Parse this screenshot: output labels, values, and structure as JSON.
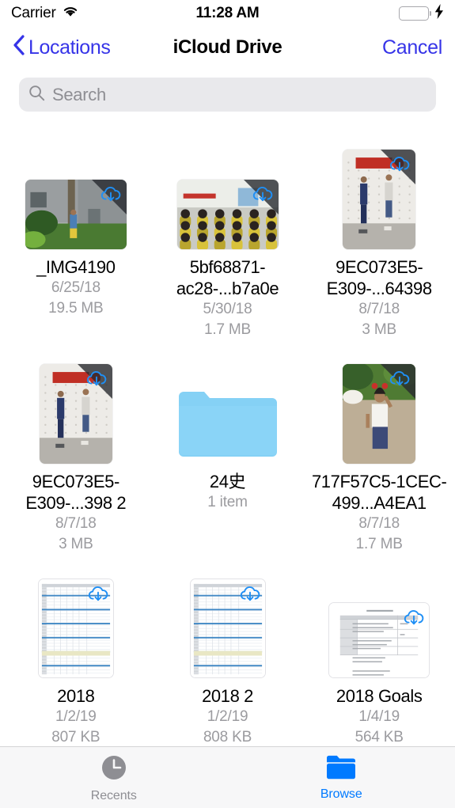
{
  "status_bar": {
    "carrier": "Carrier",
    "wifi_icon": "wifi-icon",
    "time": "11:28 AM",
    "battery_icon": "battery-icon",
    "battery_color": "#4cd964",
    "charging_icon": "lightning-bolt-icon"
  },
  "nav": {
    "back_icon": "chevron-left-icon",
    "back_label": "Locations",
    "title": "iCloud Drive",
    "cancel_label": "Cancel",
    "tint_color": "#3634e8"
  },
  "search": {
    "icon": "search-icon",
    "placeholder": "Search",
    "value": ""
  },
  "files": [
    {
      "name": "_IMG4190",
      "date": "6/25/18",
      "size": "19.5 MB",
      "kind": "photo",
      "orientation": "landscape",
      "status_icon": "icloud-download-icon"
    },
    {
      "name": "5bf68871-ac28-...b7a0e",
      "date": "5/30/18",
      "size": "1.7 MB",
      "kind": "photo",
      "orientation": "landscape",
      "status_icon": "icloud-download-icon"
    },
    {
      "name": "9EC073E5-E309-...64398",
      "date": "8/7/18",
      "size": "3 MB",
      "kind": "photo",
      "orientation": "portrait",
      "status_icon": "icloud-download-icon"
    },
    {
      "name": "9EC073E5-E309-...398 2",
      "date": "8/7/18",
      "size": "3 MB",
      "kind": "photo",
      "orientation": "portrait",
      "status_icon": "icloud-download-icon"
    },
    {
      "name": "24史",
      "date": "1 item",
      "size": "",
      "kind": "folder",
      "orientation": "",
      "status_icon": ""
    },
    {
      "name": "717F57C5-1CEC-499...A4EA1",
      "date": "8/7/18",
      "size": "1.7 MB",
      "kind": "photo",
      "orientation": "portrait",
      "status_icon": "icloud-download-icon"
    },
    {
      "name": "2018",
      "date": "1/2/19",
      "size": "807 KB",
      "kind": "spreadsheet",
      "orientation": "portrait",
      "status_icon": "icloud-download-icon"
    },
    {
      "name": "2018 2",
      "date": "1/2/19",
      "size": "808 KB",
      "kind": "spreadsheet",
      "orientation": "portrait",
      "status_icon": "icloud-download-icon"
    },
    {
      "name": "2018 Goals",
      "date": "1/4/19",
      "size": "564 KB",
      "kind": "document",
      "orientation": "landscape",
      "status_icon": "icloud-download-icon"
    }
  ],
  "tab_bar": {
    "items": [
      {
        "label": "Recents",
        "icon": "clock-icon",
        "active": false
      },
      {
        "label": "Browse",
        "icon": "folder-icon",
        "active": true
      }
    ],
    "active_color": "#007aff",
    "inactive_color": "#8e8e93"
  }
}
